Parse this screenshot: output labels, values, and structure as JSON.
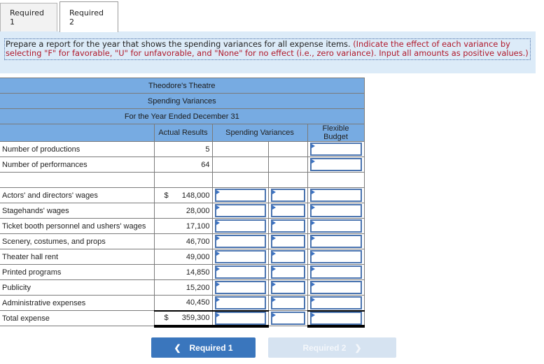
{
  "tabs": [
    {
      "label": "Required 1",
      "active": false
    },
    {
      "label": "Required 2",
      "active": true
    }
  ],
  "instructions": {
    "main": "Prepare a report for the year that shows the spending variances for all expense items. ",
    "note": "(Indicate the effect of each variance by selecting \"F\" for favorable, \"U\" for unfavorable, and \"None\" for no effect (i.e., zero variance). Input all amounts as positive values.)"
  },
  "report": {
    "company": "Theodore's Theatre",
    "title": "Spending Variances",
    "period": "For the Year Ended December 31",
    "columns": {
      "actual": "Actual Results",
      "variances": "Spending Variances",
      "flexible": "Flexible Budget"
    },
    "activity_rows": [
      {
        "label": "Number of productions",
        "actual": "5",
        "flexible": ""
      },
      {
        "label": "Number of performances",
        "actual": "64",
        "flexible": ""
      }
    ],
    "expense_rows": [
      {
        "label": "Actors' and directors' wages",
        "dollar": "$",
        "actual": "148,000",
        "variance": "",
        "effect": "",
        "flexible": ""
      },
      {
        "label": "Stagehands' wages",
        "dollar": "",
        "actual": "28,000",
        "variance": "",
        "effect": "",
        "flexible": ""
      },
      {
        "label": "Ticket booth personnel and ushers' wages",
        "dollar": "",
        "actual": "17,100",
        "variance": "",
        "effect": "",
        "flexible": ""
      },
      {
        "label": "Scenery, costumes, and props",
        "dollar": "",
        "actual": "46,700",
        "variance": "",
        "effect": "",
        "flexible": ""
      },
      {
        "label": "Theater hall rent",
        "dollar": "",
        "actual": "49,000",
        "variance": "",
        "effect": "",
        "flexible": ""
      },
      {
        "label": "Printed programs",
        "dollar": "",
        "actual": "14,850",
        "variance": "",
        "effect": "",
        "flexible": ""
      },
      {
        "label": "Publicity",
        "dollar": "",
        "actual": "15,200",
        "variance": "",
        "effect": "",
        "flexible": ""
      },
      {
        "label": "Administrative expenses",
        "dollar": "",
        "actual": "40,450",
        "variance": "",
        "effect": "",
        "flexible": ""
      }
    ],
    "total_row": {
      "label": "Total expense",
      "dollar": "$",
      "actual": "359,300",
      "variance": "",
      "effect": "",
      "flexible": ""
    }
  },
  "nav": {
    "prev_label": "Required 1",
    "prev_icon": "chevron-left-icon",
    "next_label": "Required 2",
    "next_icon": "chevron-right-icon"
  },
  "colors": {
    "header_bg": "#77abe2",
    "instruction_bg": "#dcebf8",
    "instruction_note": "#b0182a",
    "input_border": "#4a74b0",
    "nav_active": "#3a76bd",
    "nav_disabled": "#d6e3f1"
  }
}
